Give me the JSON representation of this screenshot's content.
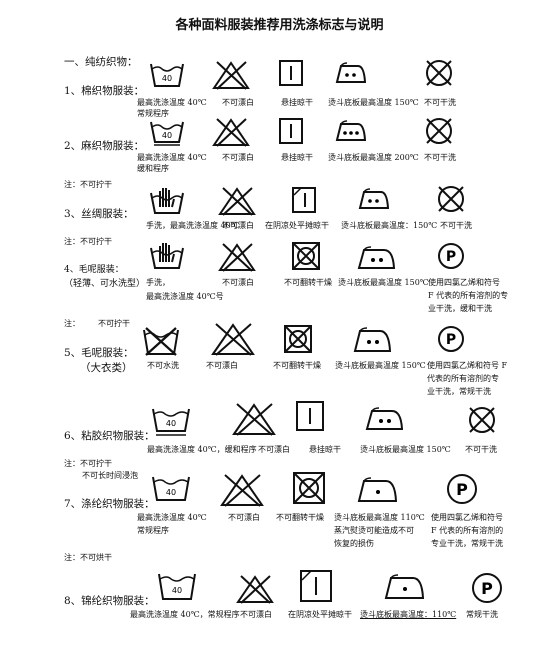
{
  "title": "各种面料服装推荐用洗涤标志与说明",
  "section": "一、纯纺织物：",
  "rows": [
    {
      "label": "1、棉织物服装：",
      "wash": "40",
      "caps": [
        "最高洗涤温度 40℃",
        "常规程序",
        "不可漂白",
        "悬挂晾干",
        "烫斗底板最高温度 150℃",
        "不可干洗"
      ]
    },
    {
      "label": "2、麻织物服装：",
      "wash": "40",
      "caps": [
        "最高洗涤温度 40℃",
        "缓和程序",
        "不可漂白",
        "悬挂晾干",
        "烫斗底板最高温度 200℃",
        "不可干洗"
      ]
    },
    {
      "label": "3、丝绸服装：",
      "caps": [
        "手洗，最高洗涤温度 40℃",
        "不可漂白",
        "在阴凉处平摊晾干",
        "烫斗底板最高温度：150℃",
        "不可干洗"
      ]
    },
    {
      "label": "4、毛呢服装：",
      "sublabel": "（轻薄、可水洗型）",
      "caps": [
        "手洗，",
        "最高洗涤温度 40℃号",
        "不可漂白",
        "不可翻转干燥",
        "烫斗底板最高温度 150℃",
        "使用四氯乙烯和符号",
        "F 代表的所有溶剂的专",
        "业干洗，缓和干洗"
      ],
      "dry": "P"
    },
    {
      "label": "5、毛呢服装：",
      "sublabel": "（大衣类）",
      "caps": [
        "不可水洗",
        "不可漂白",
        "不可翻转干燥",
        "烫斗底板最高温度 150℃",
        "使用四氯乙烯和符号 F",
        "代表的所有溶剂的专",
        "业干洗，常规干洗"
      ],
      "dry": "P"
    },
    {
      "label": "6、粘胶织物服装：",
      "wash": "40",
      "caps": [
        "最高洗涤温度 40℃，缓和程序",
        "不可漂白",
        "悬挂晾干",
        "烫斗底板最高温度 150℃",
        "不可干洗"
      ]
    },
    {
      "label": "7、涤纶织物服装：",
      "wash": "40",
      "caps": [
        "最高洗涤温度 40℃",
        "常规程序",
        "不可漂白",
        "不可翻转干燥",
        "烫斗底板最高温度 110℃",
        "蒸汽熨烫可能造成不可",
        "恢复的损伤",
        "使用四氯乙烯和符号",
        "F 代表的所有溶剂的",
        "专业干洗，常规干洗"
      ],
      "dry": "P"
    },
    {
      "label": "8、锦纶织物服装：",
      "wash": "40",
      "caps": [
        "最高洗涤温度 40℃，常规程序",
        "不可漂白",
        "在阴凉处平摊晾干",
        "烫斗底板最高温度：110℃",
        "常规干洗"
      ],
      "dry": "P"
    }
  ],
  "notes": [
    "注：不可拧干",
    "注：不可拧干",
    "注：",
    "不可拧干",
    "注：不可拧干",
    "不可长时间浸泡",
    "注：不可烘干"
  ]
}
